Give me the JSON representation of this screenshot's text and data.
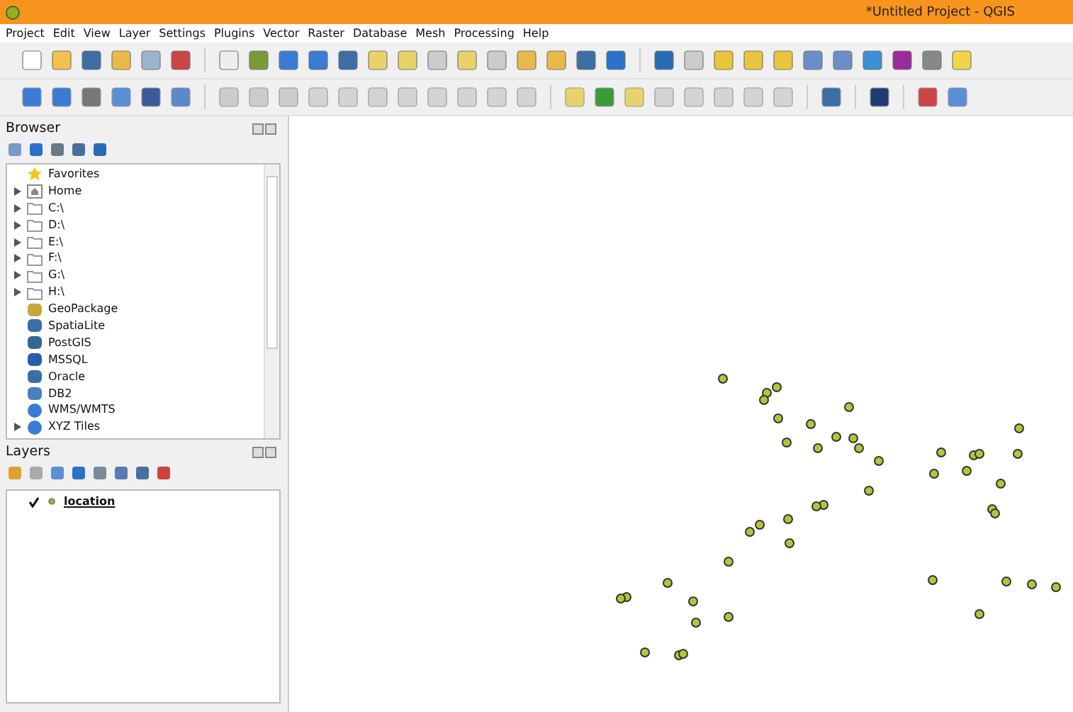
{
  "window": {
    "title": "*Untitled Project - QGIS"
  },
  "menu": [
    "Project",
    "Edit",
    "View",
    "Layer",
    "Settings",
    "Plugins",
    "Vector",
    "Raster",
    "Database",
    "Mesh",
    "Processing",
    "Help"
  ],
  "browser": {
    "title": "Browser",
    "items": [
      {
        "label": "Favorites",
        "kind": "favorites",
        "expandable": false
      },
      {
        "label": "Home",
        "kind": "home",
        "expandable": true
      },
      {
        "label": "C:\\",
        "kind": "folder",
        "expandable": true
      },
      {
        "label": "D:\\",
        "kind": "folder",
        "expandable": true
      },
      {
        "label": "E:\\",
        "kind": "folder",
        "expandable": true
      },
      {
        "label": "F:\\",
        "kind": "folder",
        "expandable": true
      },
      {
        "label": "G:\\",
        "kind": "folder",
        "expandable": true
      },
      {
        "label": "H:\\",
        "kind": "folder",
        "expandable": true
      },
      {
        "label": "GeoPackage",
        "kind": "geopackage",
        "expandable": false
      },
      {
        "label": "SpatiaLite",
        "kind": "spatialite",
        "expandable": false
      },
      {
        "label": "PostGIS",
        "kind": "postgis",
        "expandable": false
      },
      {
        "label": "MSSQL",
        "kind": "mssql",
        "expandable": false
      },
      {
        "label": "Oracle",
        "kind": "oracle",
        "expandable": false
      },
      {
        "label": "DB2",
        "kind": "db2",
        "expandable": false
      },
      {
        "label": "WMS/WMTS",
        "kind": "web",
        "expandable": false
      },
      {
        "label": "XYZ Tiles",
        "kind": "web",
        "expandable": true
      }
    ]
  },
  "layers": {
    "title": "Layers",
    "items": [
      {
        "label": "location",
        "checked": true
      }
    ]
  }
}
